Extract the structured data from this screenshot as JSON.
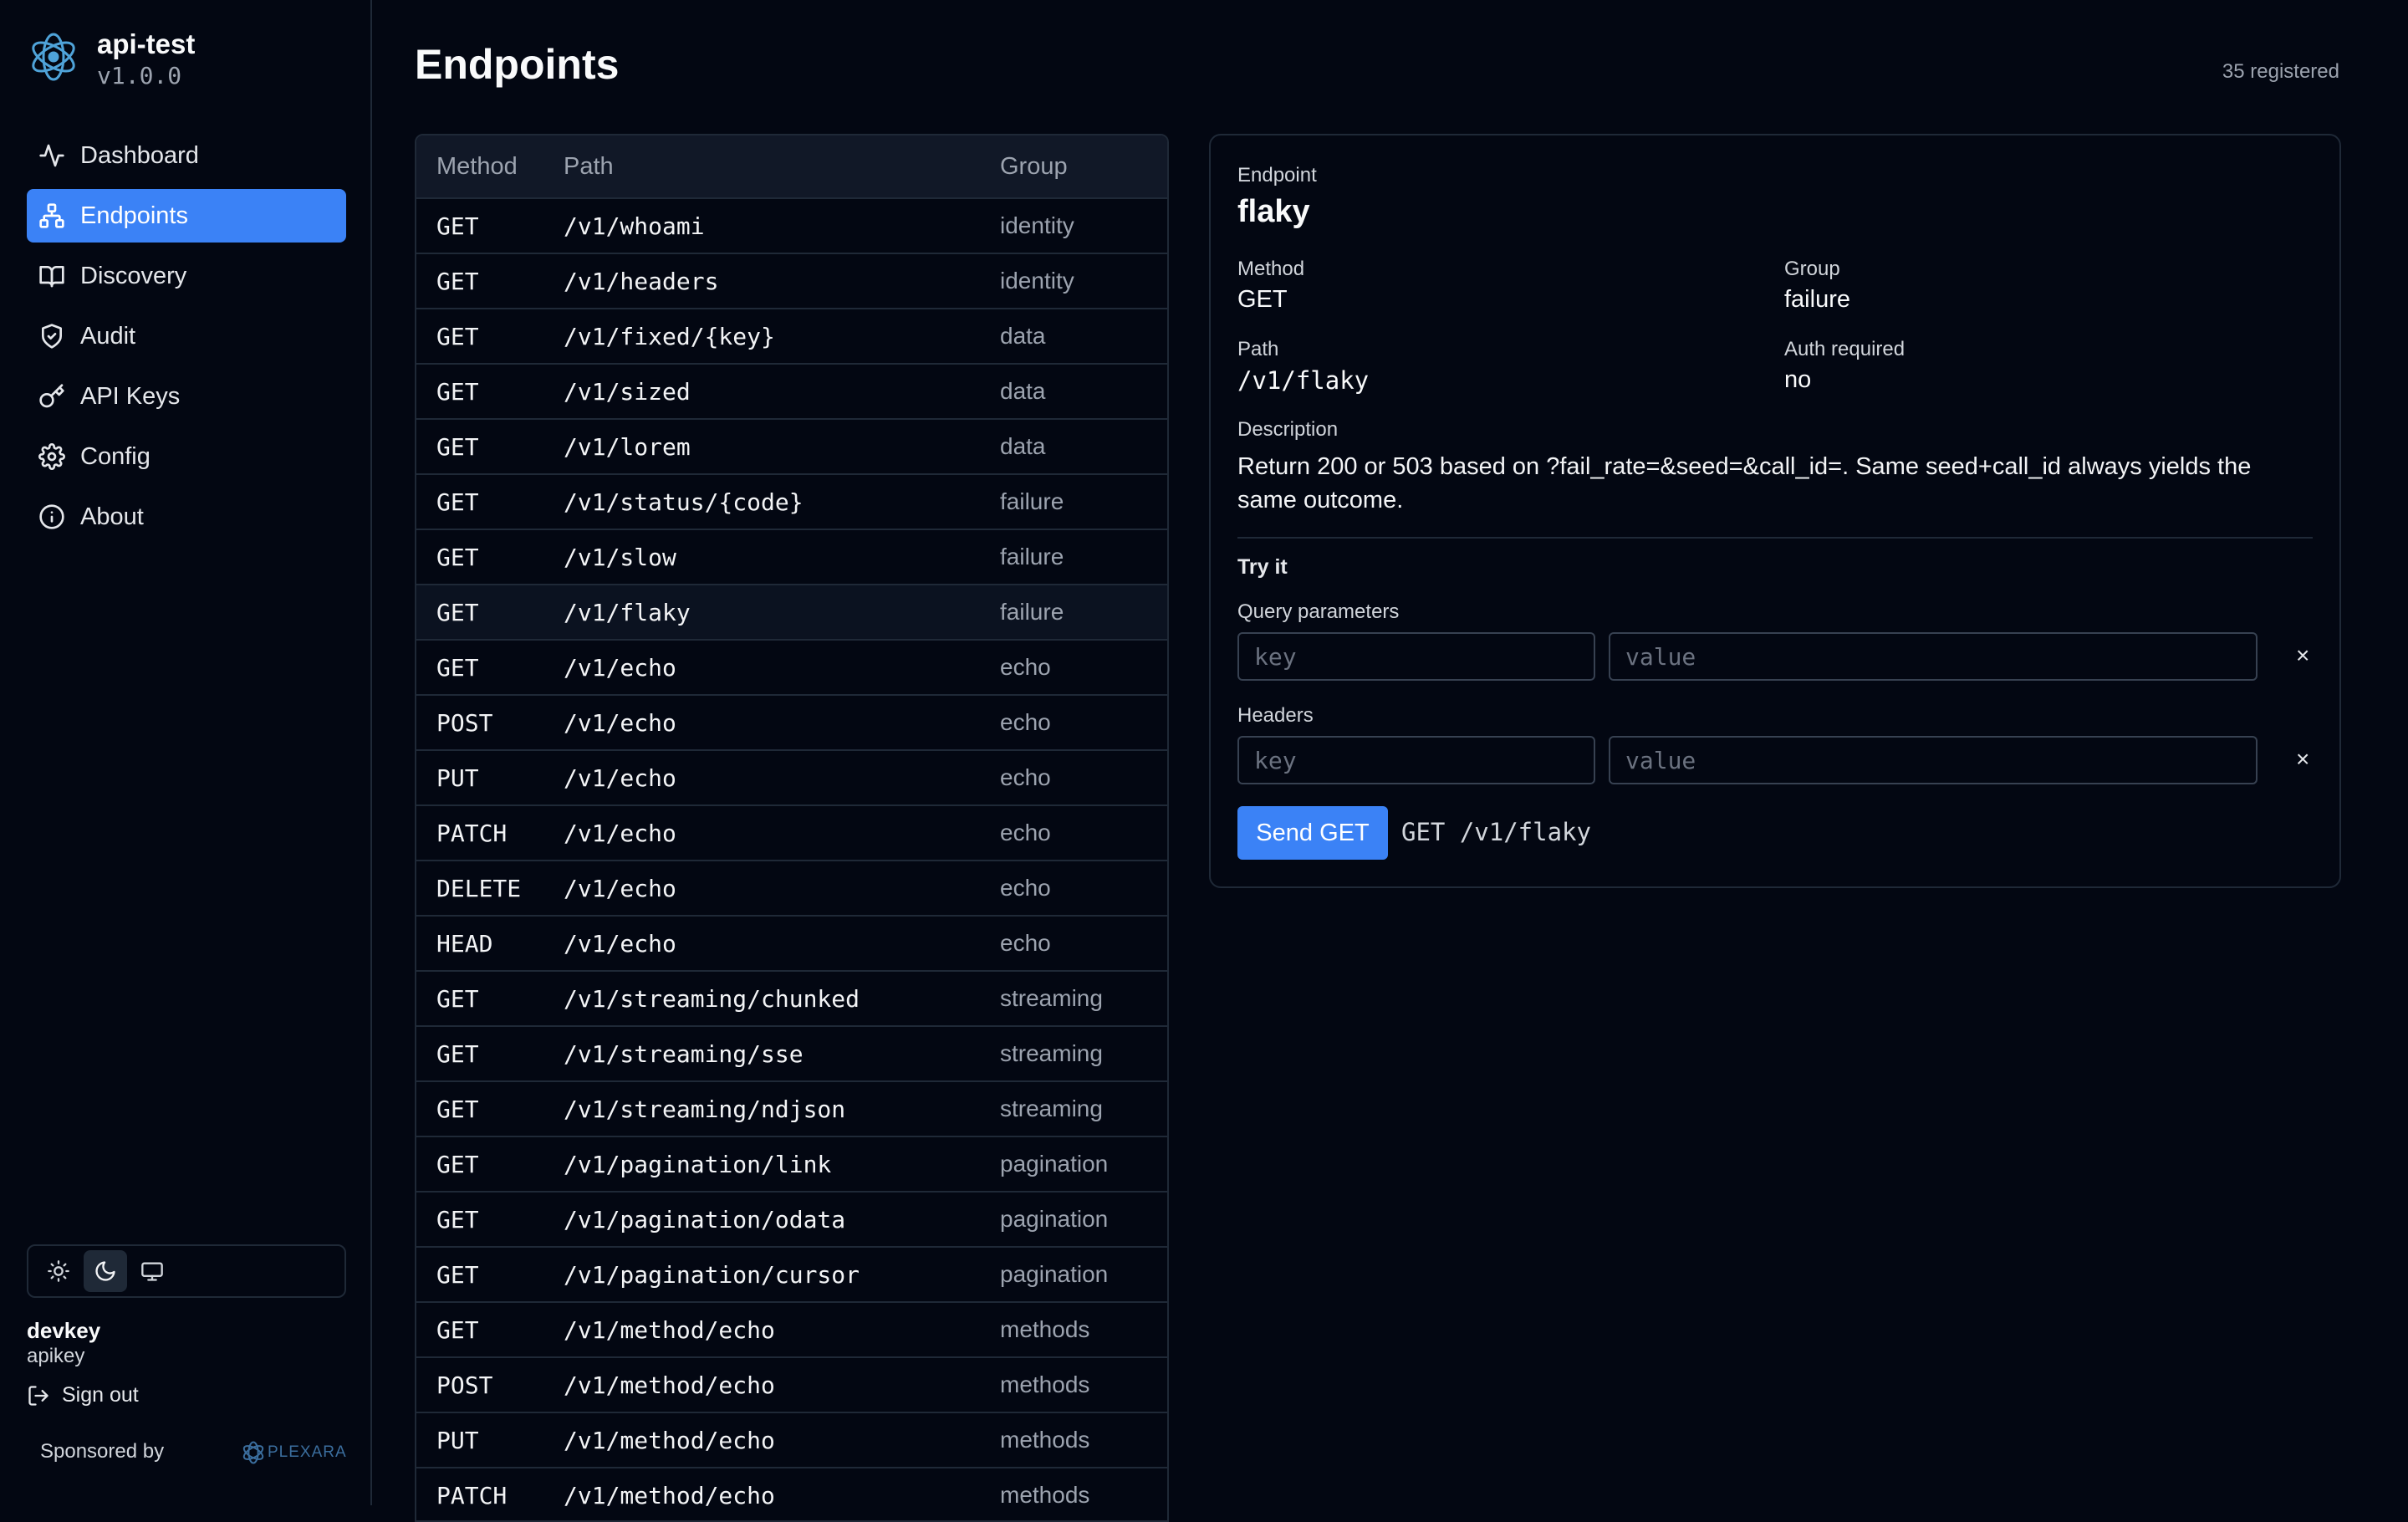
{
  "app": {
    "name": "api-test",
    "version": "v1.0.0"
  },
  "nav": [
    {
      "label": "Dashboard",
      "icon": "activity-icon"
    },
    {
      "label": "Endpoints",
      "icon": "network-icon",
      "active": true
    },
    {
      "label": "Discovery",
      "icon": "book-icon"
    },
    {
      "label": "Audit",
      "icon": "shield-icon"
    },
    {
      "label": "API Keys",
      "icon": "key-icon"
    },
    {
      "label": "Config",
      "icon": "gear-icon"
    },
    {
      "label": "About",
      "icon": "info-icon"
    }
  ],
  "theme": {
    "options": [
      "sun-icon",
      "moon-icon",
      "monitor-icon"
    ],
    "selected": "moon-icon"
  },
  "user": {
    "name": "devkey",
    "role": "apikey",
    "signout_label": "Sign out"
  },
  "sponsor": {
    "label": "Sponsored by",
    "brand": "PLEXARA"
  },
  "page": {
    "title": "Endpoints",
    "count_label": "35 registered"
  },
  "table": {
    "headers": {
      "method": "Method",
      "path": "Path",
      "group": "Group"
    },
    "selected_index": 7,
    "rows": [
      {
        "method": "GET",
        "path": "/v1/whoami",
        "group": "identity"
      },
      {
        "method": "GET",
        "path": "/v1/headers",
        "group": "identity"
      },
      {
        "method": "GET",
        "path": "/v1/fixed/{key}",
        "group": "data"
      },
      {
        "method": "GET",
        "path": "/v1/sized",
        "group": "data"
      },
      {
        "method": "GET",
        "path": "/v1/lorem",
        "group": "data"
      },
      {
        "method": "GET",
        "path": "/v1/status/{code}",
        "group": "failure"
      },
      {
        "method": "GET",
        "path": "/v1/slow",
        "group": "failure"
      },
      {
        "method": "GET",
        "path": "/v1/flaky",
        "group": "failure"
      },
      {
        "method": "GET",
        "path": "/v1/echo",
        "group": "echo"
      },
      {
        "method": "POST",
        "path": "/v1/echo",
        "group": "echo"
      },
      {
        "method": "PUT",
        "path": "/v1/echo",
        "group": "echo"
      },
      {
        "method": "PATCH",
        "path": "/v1/echo",
        "group": "echo"
      },
      {
        "method": "DELETE",
        "path": "/v1/echo",
        "group": "echo"
      },
      {
        "method": "HEAD",
        "path": "/v1/echo",
        "group": "echo"
      },
      {
        "method": "GET",
        "path": "/v1/streaming/chunked",
        "group": "streaming"
      },
      {
        "method": "GET",
        "path": "/v1/streaming/sse",
        "group": "streaming"
      },
      {
        "method": "GET",
        "path": "/v1/streaming/ndjson",
        "group": "streaming"
      },
      {
        "method": "GET",
        "path": "/v1/pagination/link",
        "group": "pagination"
      },
      {
        "method": "GET",
        "path": "/v1/pagination/odata",
        "group": "pagination"
      },
      {
        "method": "GET",
        "path": "/v1/pagination/cursor",
        "group": "pagination"
      },
      {
        "method": "GET",
        "path": "/v1/method/echo",
        "group": "methods"
      },
      {
        "method": "POST",
        "path": "/v1/method/echo",
        "group": "methods"
      },
      {
        "method": "PUT",
        "path": "/v1/method/echo",
        "group": "methods"
      },
      {
        "method": "PATCH",
        "path": "/v1/method/echo",
        "group": "methods"
      }
    ]
  },
  "detail": {
    "endpoint_label": "Endpoint",
    "endpoint_name": "flaky",
    "method_label": "Method",
    "method": "GET",
    "group_label": "Group",
    "group": "failure",
    "path_label": "Path",
    "path": "/v1/flaky",
    "auth_label": "Auth required",
    "auth": "no",
    "description_label": "Description",
    "description": "Return 200 or 503 based on ?fail_rate=&seed=&call_id=. Same seed+call_id always yields the same outcome.",
    "try_label": "Try it",
    "query_label": "Query parameters",
    "headers_label": "Headers",
    "key_placeholder": "key",
    "value_placeholder": "value",
    "remove_glyph": "×",
    "send_label": "Send GET",
    "request_preview": "GET /v1/flaky"
  },
  "colors": {
    "accent": "#3b82f6",
    "background": "#030712",
    "border": "#1f2937"
  }
}
